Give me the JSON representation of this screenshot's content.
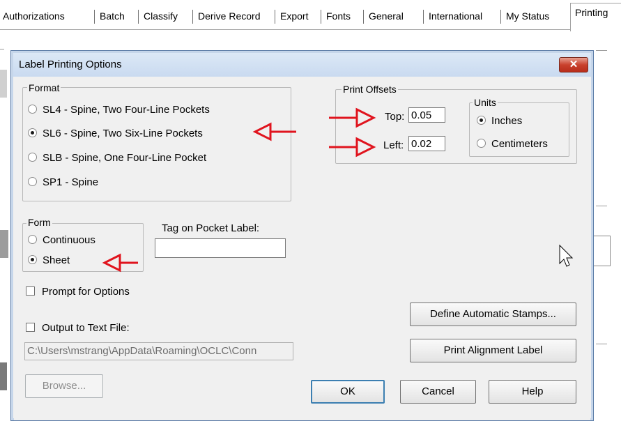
{
  "tabs": [
    {
      "label": "Authorizations"
    },
    {
      "label": "Batch"
    },
    {
      "label": "Classify"
    },
    {
      "label": "Derive Record"
    },
    {
      "label": "Export"
    },
    {
      "label": "Fonts"
    },
    {
      "label": "General"
    },
    {
      "label": "International"
    },
    {
      "label": "My Status"
    },
    {
      "label": "Printing",
      "active": true
    }
  ],
  "dialog": {
    "title": "Label Printing Options",
    "close_glyph": "✕",
    "format": {
      "legend": "Format",
      "options": [
        {
          "label": "SL4 - Spine, Two Four-Line Pockets",
          "selected": false
        },
        {
          "label": "SL6 - Spine, Two Six-Line Pockets",
          "selected": true
        },
        {
          "label": "SLB - Spine, One Four-Line Pocket",
          "selected": false
        },
        {
          "label": "SP1 - Spine",
          "selected": false
        }
      ]
    },
    "print_offsets": {
      "legend": "Print Offsets",
      "top_label": "Top:",
      "top_value": "0.05",
      "left_label": "Left:",
      "left_value": "0.02"
    },
    "units": {
      "legend": "Units",
      "options": [
        {
          "label": "Inches",
          "selected": true
        },
        {
          "label": "Centimeters",
          "selected": false
        }
      ]
    },
    "form": {
      "legend": "Form",
      "options": [
        {
          "label": "Continuous",
          "selected": false
        },
        {
          "label": "Sheet",
          "selected": true
        }
      ]
    },
    "tag_on_pocket_label": {
      "label": "Tag on Pocket Label:",
      "value": ""
    },
    "prompt_for_options": {
      "label": "Prompt for Options",
      "checked": false
    },
    "output_to_text_file": {
      "label": "Output to Text File:",
      "checked": false,
      "path": "C:\\Users\\mstrang\\AppData\\Roaming\\OCLC\\Conn"
    },
    "buttons": {
      "browse": "Browse...",
      "define_stamps": "Define Automatic Stamps...",
      "print_alignment": "Print Alignment Label",
      "ok": "OK",
      "cancel": "Cancel",
      "help": "Help"
    }
  },
  "annotation_color": "#e0141e",
  "icons": [
    "close-icon",
    "mouse-cursor-icon",
    "annotation-arrow-icon"
  ]
}
